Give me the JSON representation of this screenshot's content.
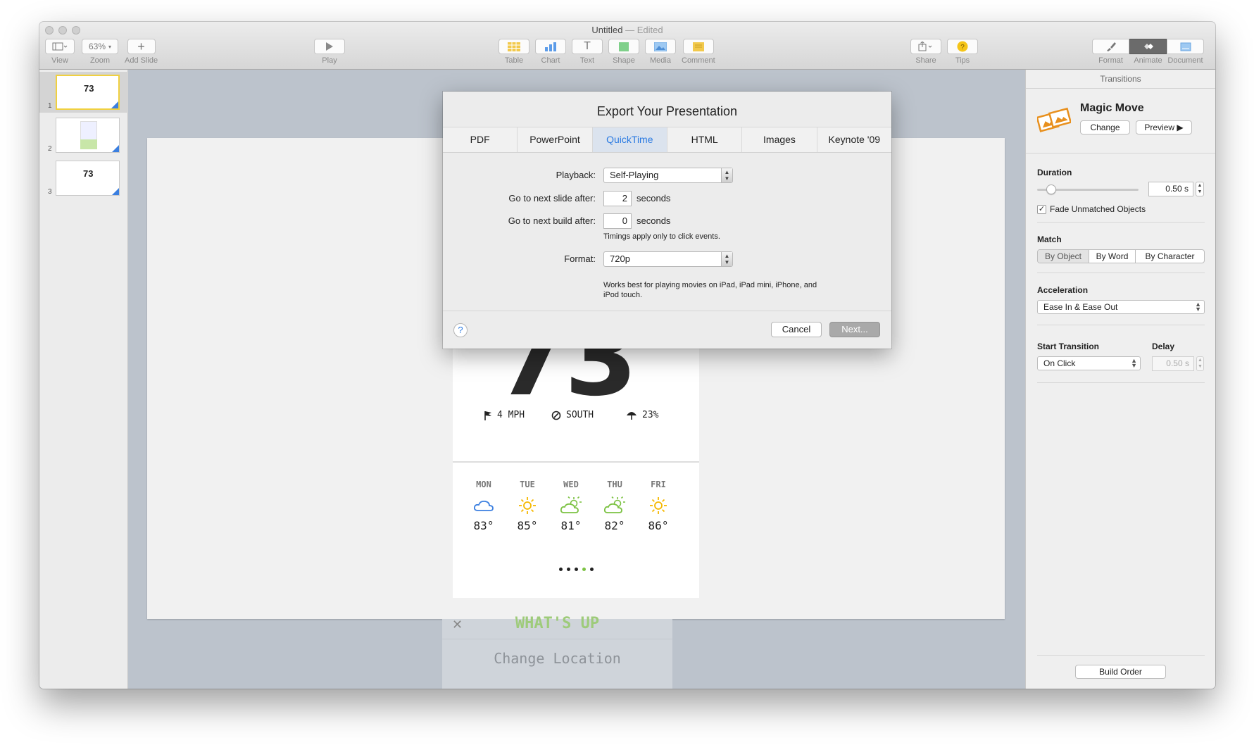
{
  "window": {
    "title": "Untitled",
    "title_sep": "—",
    "title_state": "Edited"
  },
  "toolbar": {
    "view_label": "View",
    "zoom_value": "63%",
    "zoom_label": "Zoom",
    "add_slide_label": "Add Slide",
    "play_label": "Play",
    "table_label": "Table",
    "chart_label": "Chart",
    "text_label": "Text",
    "shape_label": "Shape",
    "media_label": "Media",
    "comment_label": "Comment",
    "share_label": "Share",
    "tips_label": "Tips",
    "format_label": "Format",
    "animate_label": "Animate",
    "document_label": "Document"
  },
  "slides": [
    {
      "number": "1",
      "preview": "73",
      "selected": true
    },
    {
      "number": "2",
      "preview": "",
      "selected": false
    },
    {
      "number": "3",
      "preview": "73",
      "selected": false
    }
  ],
  "slide_content": {
    "temp": "73",
    "wind_speed": "4 MPH",
    "wind_dir": "SOUTH",
    "precip": "23%",
    "forecast": [
      {
        "day": "MON",
        "temp": "83°",
        "icon": "cloud-icon"
      },
      {
        "day": "TUE",
        "temp": "85°",
        "icon": "sun-icon"
      },
      {
        "day": "WED",
        "temp": "81°",
        "icon": "partly-cloudy-icon"
      },
      {
        "day": "THU",
        "temp": "82°",
        "icon": "partly-cloudy-icon"
      },
      {
        "day": "FRI",
        "temp": "86°",
        "icon": "sun-icon"
      }
    ],
    "below_title": "WHAT'S UP",
    "change_location": "Change Location"
  },
  "dialog": {
    "title": "Export Your Presentation",
    "tabs": [
      "PDF",
      "PowerPoint",
      "QuickTime",
      "HTML",
      "Images",
      "Keynote '09"
    ],
    "active_tab": "QuickTime",
    "playback_label": "Playback:",
    "playback_value": "Self-Playing",
    "next_slide_label": "Go to next slide after:",
    "next_slide_value": "2",
    "next_build_label": "Go to next build after:",
    "next_build_value": "0",
    "seconds": "seconds",
    "timing_note": "Timings apply only to click events.",
    "format_label": "Format:",
    "format_value": "720p",
    "format_note_1": "Works best for playing movies on iPad, iPad mini, iPhone, and",
    "format_note_2": "iPod touch.",
    "help": "?",
    "cancel": "Cancel",
    "next": "Next..."
  },
  "inspector": {
    "header": "Transitions",
    "transition_name": "Magic Move",
    "change": "Change",
    "preview": "Preview ▶",
    "duration_label": "Duration",
    "duration_value": "0.50 s",
    "duration_fraction": 0.1,
    "fade_label": "Fade Unmatched Objects",
    "fade_checked": true,
    "match_label": "Match",
    "match_options": [
      "By Object",
      "By Word",
      "By Character"
    ],
    "match_selected": "By Object",
    "accel_label": "Acceleration",
    "accel_value": "Ease In & Ease Out",
    "start_label": "Start Transition",
    "start_value": "On Click",
    "delay_label": "Delay",
    "delay_value": "0.50 s",
    "build_order": "Build Order"
  },
  "colors": {
    "accent": "#2a7ae2",
    "selection": "#f0d040",
    "sun": "#f5b800",
    "green": "#7cc243",
    "cloud": "#3b7fe0"
  }
}
